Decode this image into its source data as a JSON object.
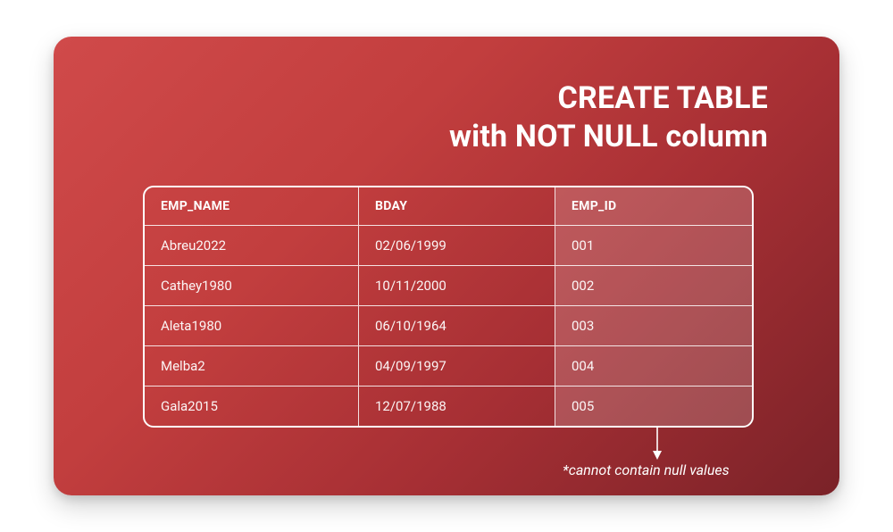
{
  "title": {
    "line1": "CREATE TABLE",
    "line2": "with NOT NULL column"
  },
  "headers": {
    "emp_name": "EMP_NAME",
    "bday": "BDAY",
    "emp_id": "EMP_ID"
  },
  "rows": [
    {
      "emp_name": "Abreu2022",
      "bday": "02/06/1999",
      "emp_id": "001"
    },
    {
      "emp_name": "Cathey1980",
      "bday": "10/11/2000",
      "emp_id": "002"
    },
    {
      "emp_name": "Aleta1980",
      "bday": "06/10/1964",
      "emp_id": "003"
    },
    {
      "emp_name": "Melba2",
      "bday": "04/09/1997",
      "emp_id": "004"
    },
    {
      "emp_name": "Gala2015",
      "bday": "12/07/1988",
      "emp_id": "005"
    }
  ],
  "annotation": "*cannot contain null values",
  "chart_data": {
    "type": "table",
    "title": "CREATE TABLE with NOT NULL column",
    "columns": [
      "EMP_NAME",
      "BDAY",
      "EMP_ID"
    ],
    "not_null_columns": [
      "EMP_ID"
    ],
    "rows": [
      [
        "Abreu2022",
        "02/06/1999",
        "001"
      ],
      [
        "Cathey1980",
        "10/11/2000",
        "002"
      ],
      [
        "Aleta1980",
        "06/10/1964",
        "003"
      ],
      [
        "Melba2",
        "04/09/1997",
        "004"
      ],
      [
        "Gala2015",
        "12/07/1988",
        "005"
      ]
    ],
    "annotation": "EMP_ID column cannot contain null values"
  }
}
